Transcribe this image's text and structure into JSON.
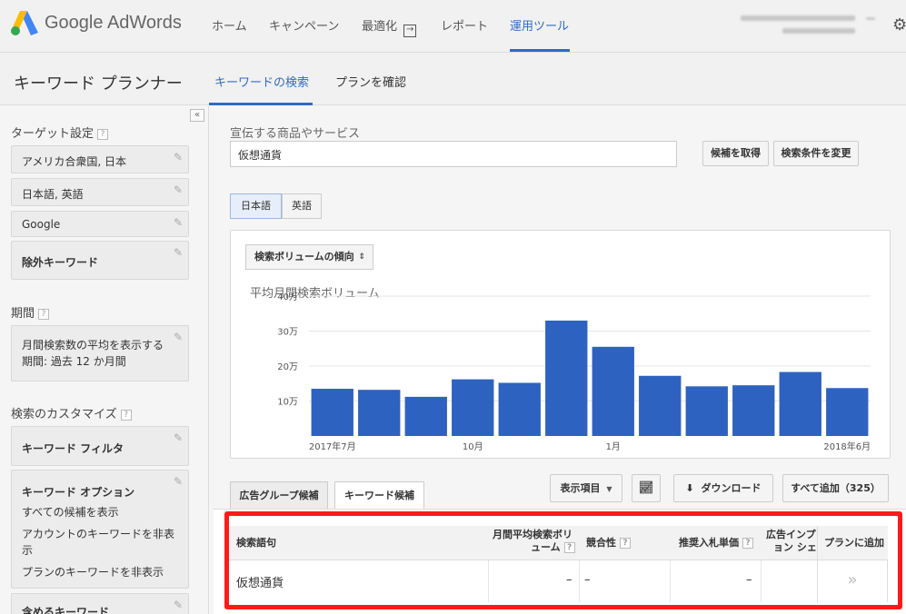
{
  "app": {
    "logo_text": "Google AdWords",
    "logo_colors": {
      "blue": "#4285f4",
      "green": "#34a853",
      "yellow": "#fbbc05"
    },
    "accent": "#2e6bc6"
  },
  "nav": {
    "items": [
      {
        "label": "ホーム"
      },
      {
        "label": "キャンペーン"
      },
      {
        "label": "最適化"
      },
      {
        "label": "レポート"
      },
      {
        "label": "運用ツール"
      }
    ],
    "active": "運用ツール"
  },
  "subheader": {
    "title": "キーワード プランナー",
    "tabs": [
      {
        "label": "キーワードの検索"
      },
      {
        "label": "プランを確認"
      }
    ]
  },
  "sidebar": {
    "collapse_icon": "«",
    "targeting_heading": "ターゲット設定",
    "targeting": {
      "location": "アメリカ合衆国, 日本",
      "language": "日本語, 英語",
      "network": "Google",
      "negative": "除外キーワード"
    },
    "period_heading": "期間",
    "period_line1": "月間検索数の平均を表示する",
    "period_line2": "期間: 過去 12 か月間",
    "customize_heading": "検索のカスタマイズ",
    "keyword_filter": "キーワード フィルタ",
    "keyword_options": "キーワード オプション",
    "option1": "すべての候補を表示",
    "option2a": "アカウントのキーワードを非表",
    "option2b": "示",
    "option3": "プランのキーワードを非表示",
    "include_keywords": "含めるキーワード"
  },
  "search": {
    "label": "宣伝する商品やサービス",
    "value": "仮想通貨",
    "get_ideas": "候補を取得",
    "modify_search": "検索条件を変更"
  },
  "languages": [
    {
      "label": "日本語",
      "selected": true
    },
    {
      "label": "英語",
      "selected": false
    }
  ],
  "chart_toggle": "検索ボリュームの傾向",
  "chart_data": {
    "type": "bar",
    "title": "平均月間検索ボリューム",
    "categories": [
      "2017-07",
      "2017-08",
      "2017-09",
      "2017-10",
      "2017-11",
      "2017-12",
      "2018-01",
      "2018-02",
      "2018-03",
      "2018-04",
      "2018-05",
      "2018-06"
    ],
    "values": [
      135000,
      132000,
      112000,
      162000,
      152000,
      330000,
      255000,
      172000,
      142000,
      145000,
      183000,
      137000
    ],
    "y_ticks": [
      {
        "value": 100000,
        "label": "10万"
      },
      {
        "value": 200000,
        "label": "20万"
      },
      {
        "value": 300000,
        "label": "30万"
      },
      {
        "value": 400000,
        "label": "40万"
      }
    ],
    "x_tick_labels": [
      {
        "index": 0,
        "label": "2017年7月"
      },
      {
        "index": 3,
        "label": "10月"
      },
      {
        "index": 6,
        "label": "1月"
      },
      {
        "index": 11,
        "label": "2018年6月"
      }
    ],
    "ylim": [
      0,
      400000
    ],
    "bar_color": "#2e62c0",
    "grid": true
  },
  "result_tabs": [
    {
      "label": "広告グループ候補"
    },
    {
      "label": "キーワード候補"
    }
  ],
  "toolbar": {
    "columns": "表示項目",
    "download": "ダウンロード",
    "add_all": "すべて追加（325）"
  },
  "table": {
    "headers": {
      "keyword": "検索語句",
      "volume1": "月間平均検索ボリ",
      "volume2": "ューム",
      "competition": "競合性",
      "bid": "推奨入札単価",
      "share1": "広告インプ",
      "share2": "ョン シェ",
      "add": "プランに追加"
    },
    "rows": [
      {
        "keyword": "仮想通貨",
        "volume": "–",
        "competition": "–",
        "bid": "–",
        "add": "»"
      }
    ]
  }
}
